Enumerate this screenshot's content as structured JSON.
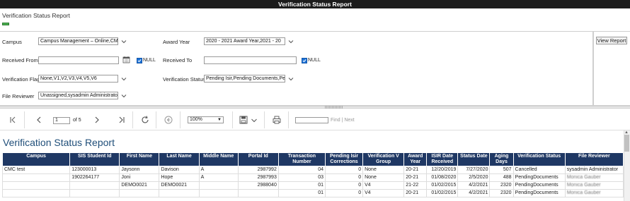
{
  "window": {
    "title": "Verification Status Report"
  },
  "page": {
    "title": "Verification Status Report"
  },
  "params": {
    "campus_label": "Campus",
    "campus_value": "Campus Management – Online,CM",
    "award_year_label": "Award Year",
    "award_year_value": "2020 - 2021 Award Year,2021 - 20",
    "received_from_label": "Received From",
    "received_from_value": "",
    "received_to_label": "Received To",
    "received_to_value": "",
    "null_label": "NULL",
    "verification_flag_label": "Verification Flag",
    "verification_flag_value": "None,V1,V2,V3,V4,V5,V6",
    "verification_status_label": "Verification Status",
    "verification_status_value": "Pending Isir,Pending Documents,Pe",
    "file_reviewer_label": "File Reviewer",
    "file_reviewer_value": "Unassigned,sysadmin Administrato",
    "view_report_label": "View Report"
  },
  "toolbar": {
    "page_number": "1",
    "page_of": "of 5",
    "zoom": "100%",
    "find_label": "Find",
    "next_label": "Next",
    "separator": "|"
  },
  "report": {
    "title": "Verification Status Report",
    "columns": [
      "Campus",
      "SIS Student Id",
      "First Name",
      "Last Name",
      "Middle Name",
      "Portal Id",
      "Transaction Number",
      "Pending Isir Corrections",
      "Verification V Group",
      "Award Year",
      "ISIR Date Received",
      "Status Date",
      "Aging Days",
      "Verification Status",
      "File Reviewer"
    ],
    "rows": [
      [
        "CMC test",
        "123000013",
        "Jaysonn",
        "Davison",
        "A",
        "2987992",
        "04",
        "0",
        "None",
        "20-21",
        "12/20/2019",
        "7/27/2020",
        "507",
        "Cancelled",
        "sysadmin Administrator"
      ],
      [
        "",
        "1902264177",
        "Joni",
        "Hope",
        "A",
        "2987993",
        "03",
        "0",
        "None",
        "20-21",
        "01/08/2020",
        "2/5/2020",
        "488",
        "PendingDocuments",
        "Monica Gauber"
      ],
      [
        "",
        "",
        "DEMO0021",
        "DEMO0021",
        "",
        "2988040",
        "01",
        "0",
        "V4",
        "21-22",
        "01/02/2015",
        "4/2/2021",
        "2320",
        "PendingDocuments",
        "Monica Gauber"
      ],
      [
        "",
        "",
        "",
        "",
        "",
        "",
        "01",
        "0",
        "V4",
        "20-21",
        "01/02/2015",
        "4/2/2021",
        "2320",
        "PendingDocuments",
        "Monica Gauber"
      ]
    ]
  },
  "colors": {
    "header_bg": "#1f3864",
    "title_color": "#1f4e79",
    "checkbox": "#1e73d8"
  }
}
